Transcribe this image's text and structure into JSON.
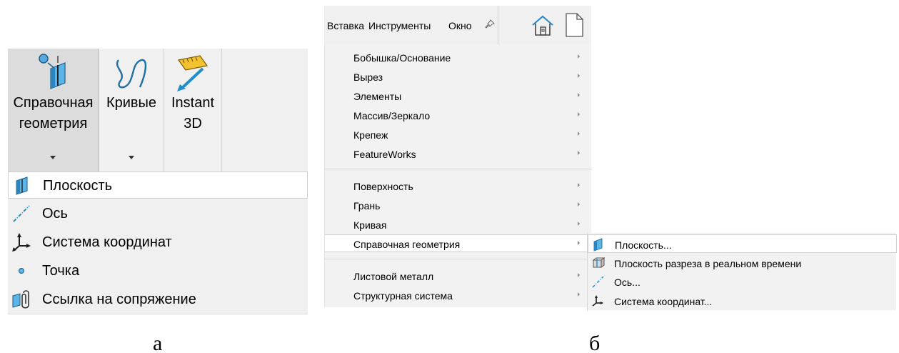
{
  "panel_a": {
    "ribbon": {
      "buttons": [
        {
          "label": "Справочная\nгеометрия",
          "icon": "reference-plane-icon",
          "has_dropdown": true,
          "active": true
        },
        {
          "label": "Кривые",
          "icon": "curves-icon",
          "has_dropdown": true,
          "active": false
        },
        {
          "label": "Instant\n3D",
          "icon": "instant3d-icon",
          "has_dropdown": false,
          "active": false
        }
      ]
    },
    "flyout": {
      "items": [
        {
          "label": "Плоскость",
          "icon": "plane-icon",
          "highlighted": true
        },
        {
          "label": "Ось",
          "icon": "axis-icon",
          "highlighted": false
        },
        {
          "label": "Система координат",
          "icon": "coordinate-system-icon",
          "highlighted": false
        },
        {
          "label": "Точка",
          "icon": "point-icon",
          "highlighted": false
        },
        {
          "label": "Ссылка на сопряжение",
          "icon": "mate-reference-icon",
          "highlighted": false
        }
      ]
    },
    "caption": "а"
  },
  "panel_b": {
    "menubar": {
      "tabs": [
        "Вставка",
        "Инструменты",
        "Окно"
      ],
      "pin_icon": "pin-icon",
      "home_icon": "home-icon",
      "new_document_icon": "new-document-icon"
    },
    "menu": {
      "groups": [
        [
          "Бобышка/Основание",
          "Вырез",
          "Элементы",
          "Массив/Зеркало",
          "Крепеж",
          "FeatureWorks"
        ],
        [
          "Поверхность",
          "Грань",
          "Кривая",
          "Справочная геометрия"
        ],
        [
          "Листовой металл",
          "Структурная система"
        ]
      ],
      "highlighted_item": "Справочная геометрия"
    },
    "submenu": {
      "items": [
        {
          "label": "Плоскость...",
          "icon": "plane-icon",
          "highlighted": true
        },
        {
          "label": "Плоскость разреза в реальном времени",
          "icon": "live-section-plane-icon",
          "highlighted": false
        },
        {
          "label": "Ось...",
          "icon": "axis-icon",
          "highlighted": false
        },
        {
          "label": "Система координат...",
          "icon": "coordinate-system-icon",
          "highlighted": false
        }
      ]
    },
    "caption": "б"
  },
  "colors": {
    "panel_bg": "#f0f0f0",
    "active_bg": "#dcdcdc",
    "highlight_bg": "#ffffff",
    "icon_blue": "#1f8fc9",
    "icon_dark": "#1c1c1c"
  }
}
